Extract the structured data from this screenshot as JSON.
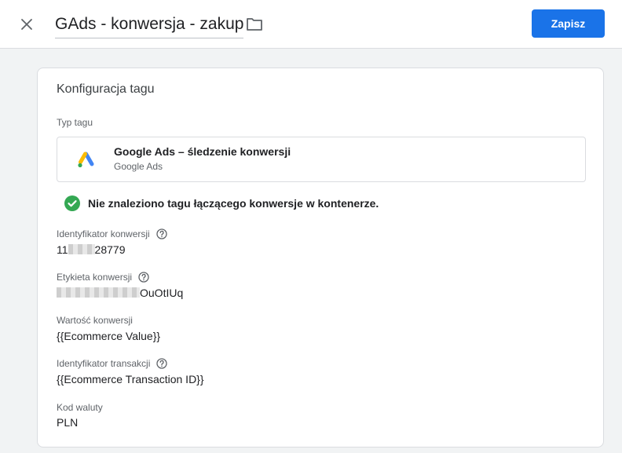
{
  "header": {
    "title": "GAds - konwersja - zakup",
    "save_label": "Zapisz",
    "close_icon": "close-icon",
    "folder_icon": "folder-icon"
  },
  "colors": {
    "primary": "#1a73e8",
    "success": "#34a853",
    "background": "#f1f3f4"
  },
  "config": {
    "section_title": "Konfiguracja tagu",
    "tag_type_label": "Typ tagu",
    "tag_type": {
      "name": "Google Ads – śledzenie konwersji",
      "provider": "Google Ads",
      "icon": "google-ads-logo"
    },
    "notice": "Nie znaleziono tagu łączącego konwersje w kontenerze.",
    "fields": {
      "conversion_id": {
        "label": "Identyfikator konwersji",
        "value_prefix": "11",
        "value_suffix": "28779"
      },
      "conversion_label": {
        "label": "Etykieta konwersji",
        "value_suffix": "OuOtIUq"
      },
      "conversion_value": {
        "label": "Wartość konwersji",
        "value": "{{Ecommerce Value}}"
      },
      "transaction_id": {
        "label": "Identyfikator transakcji",
        "value": "{{Ecommerce Transaction ID}}"
      },
      "currency": {
        "label": "Kod waluty",
        "value": "PLN"
      }
    }
  }
}
